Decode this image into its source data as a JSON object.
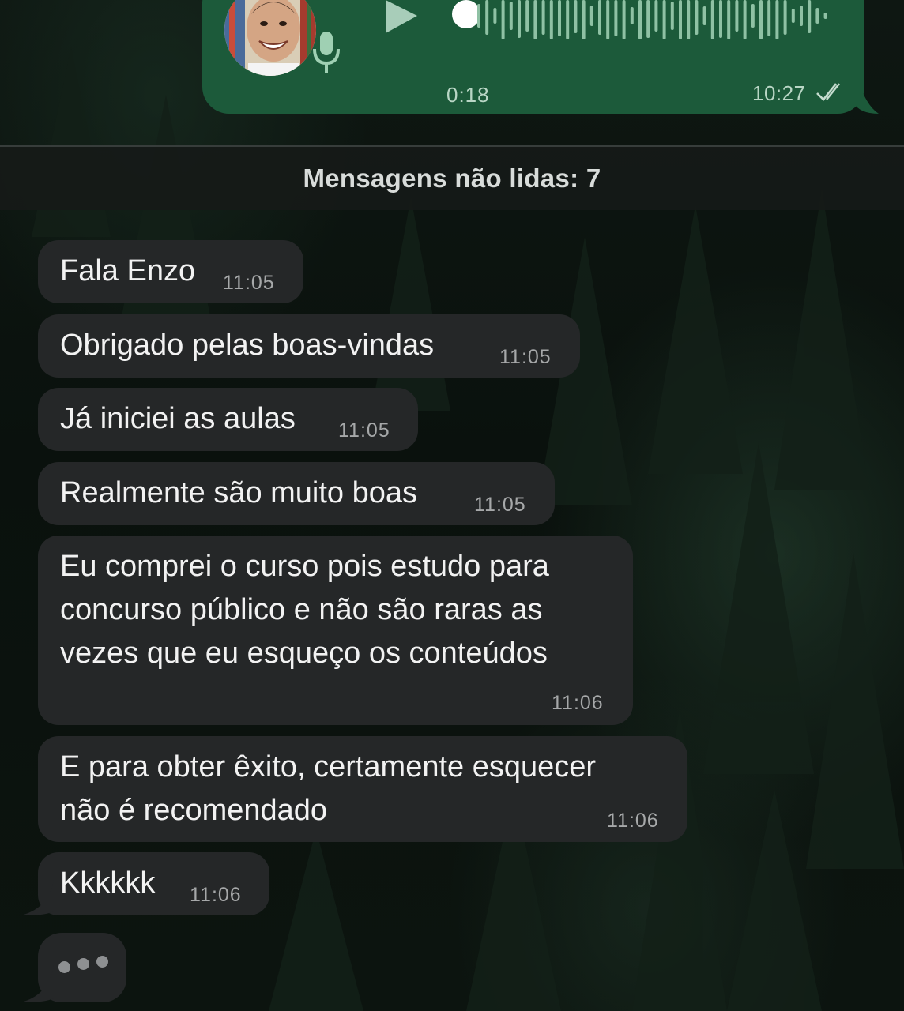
{
  "voice_message": {
    "duration": "0:18",
    "time": "10:27",
    "avatar_icon": "contact-avatar",
    "mic_icon": "microphone-icon",
    "play_icon": "play-icon",
    "status_icon": "double-check-icon",
    "progress": 0.0
  },
  "unread_banner": {
    "label": "Mensagens não lidas: 7"
  },
  "messages": [
    {
      "text": "Fala Enzo",
      "time": "11:05"
    },
    {
      "text": "Obrigado pelas boas-vindas",
      "time": "11:05"
    },
    {
      "text": "Já iniciei as aulas",
      "time": "11:05"
    },
    {
      "text": "Realmente são muito boas",
      "time": "11:05"
    },
    {
      "lines": [
        "Eu comprei o curso pois estudo para",
        "concurso público e não são raras as",
        "vezes que eu esqueço os conteúdos"
      ],
      "time": "11:06"
    },
    {
      "lines": [
        "E para obter êxito, certamente esquecer",
        "não é recomendado"
      ],
      "time": "11:06"
    },
    {
      "text": "Kkkkkk",
      "time": "11:06"
    }
  ],
  "typing_indicator": {
    "icon": "typing-dots-icon"
  },
  "colors": {
    "outgoing_bubble": "#1c5a3a",
    "incoming_bubble": "#252728",
    "timestamp": "#a6a8a9"
  }
}
